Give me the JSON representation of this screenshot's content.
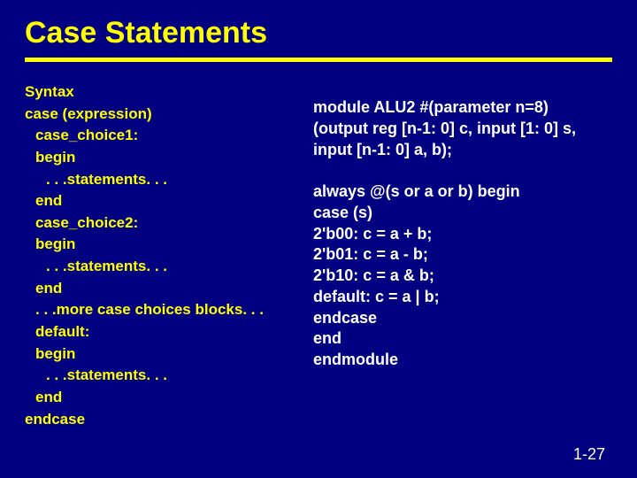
{
  "title": "Case Statements",
  "syntax": {
    "heading": "Syntax",
    "l1": "case (expression)",
    "l2": "case_choice1:",
    "l3": "begin",
    "l4": ". . .statements. . .",
    "l5": "end",
    "l6": "case_choice2:",
    "l7": "begin",
    "l8": ". . .statements. . .",
    "l9": "end",
    "l10": ". . .more case choices blocks. . .",
    "l11": "default:",
    "l12": "begin",
    "l13": ". . .statements. . .",
    "l14": "end",
    "l15": "endcase"
  },
  "code": {
    "l1": "module ALU2 #(parameter n=8)",
    "l2": "(output reg [n-1: 0] c, input [1: 0] s,",
    "l3": "input [n-1: 0] a, b);",
    "l4": "",
    "l5": "always @(s or a or b) begin",
    "l6": "case (s)",
    "l7": "2'b00:   c = a + b;",
    "l8": "2'b01:   c = a - b;",
    "l9": "2'b10:   c = a & b;",
    "l10": "default: c = a | b;",
    "l11": "endcase",
    "l12": "end",
    "l13": "endmodule"
  },
  "page_number": "1-27"
}
